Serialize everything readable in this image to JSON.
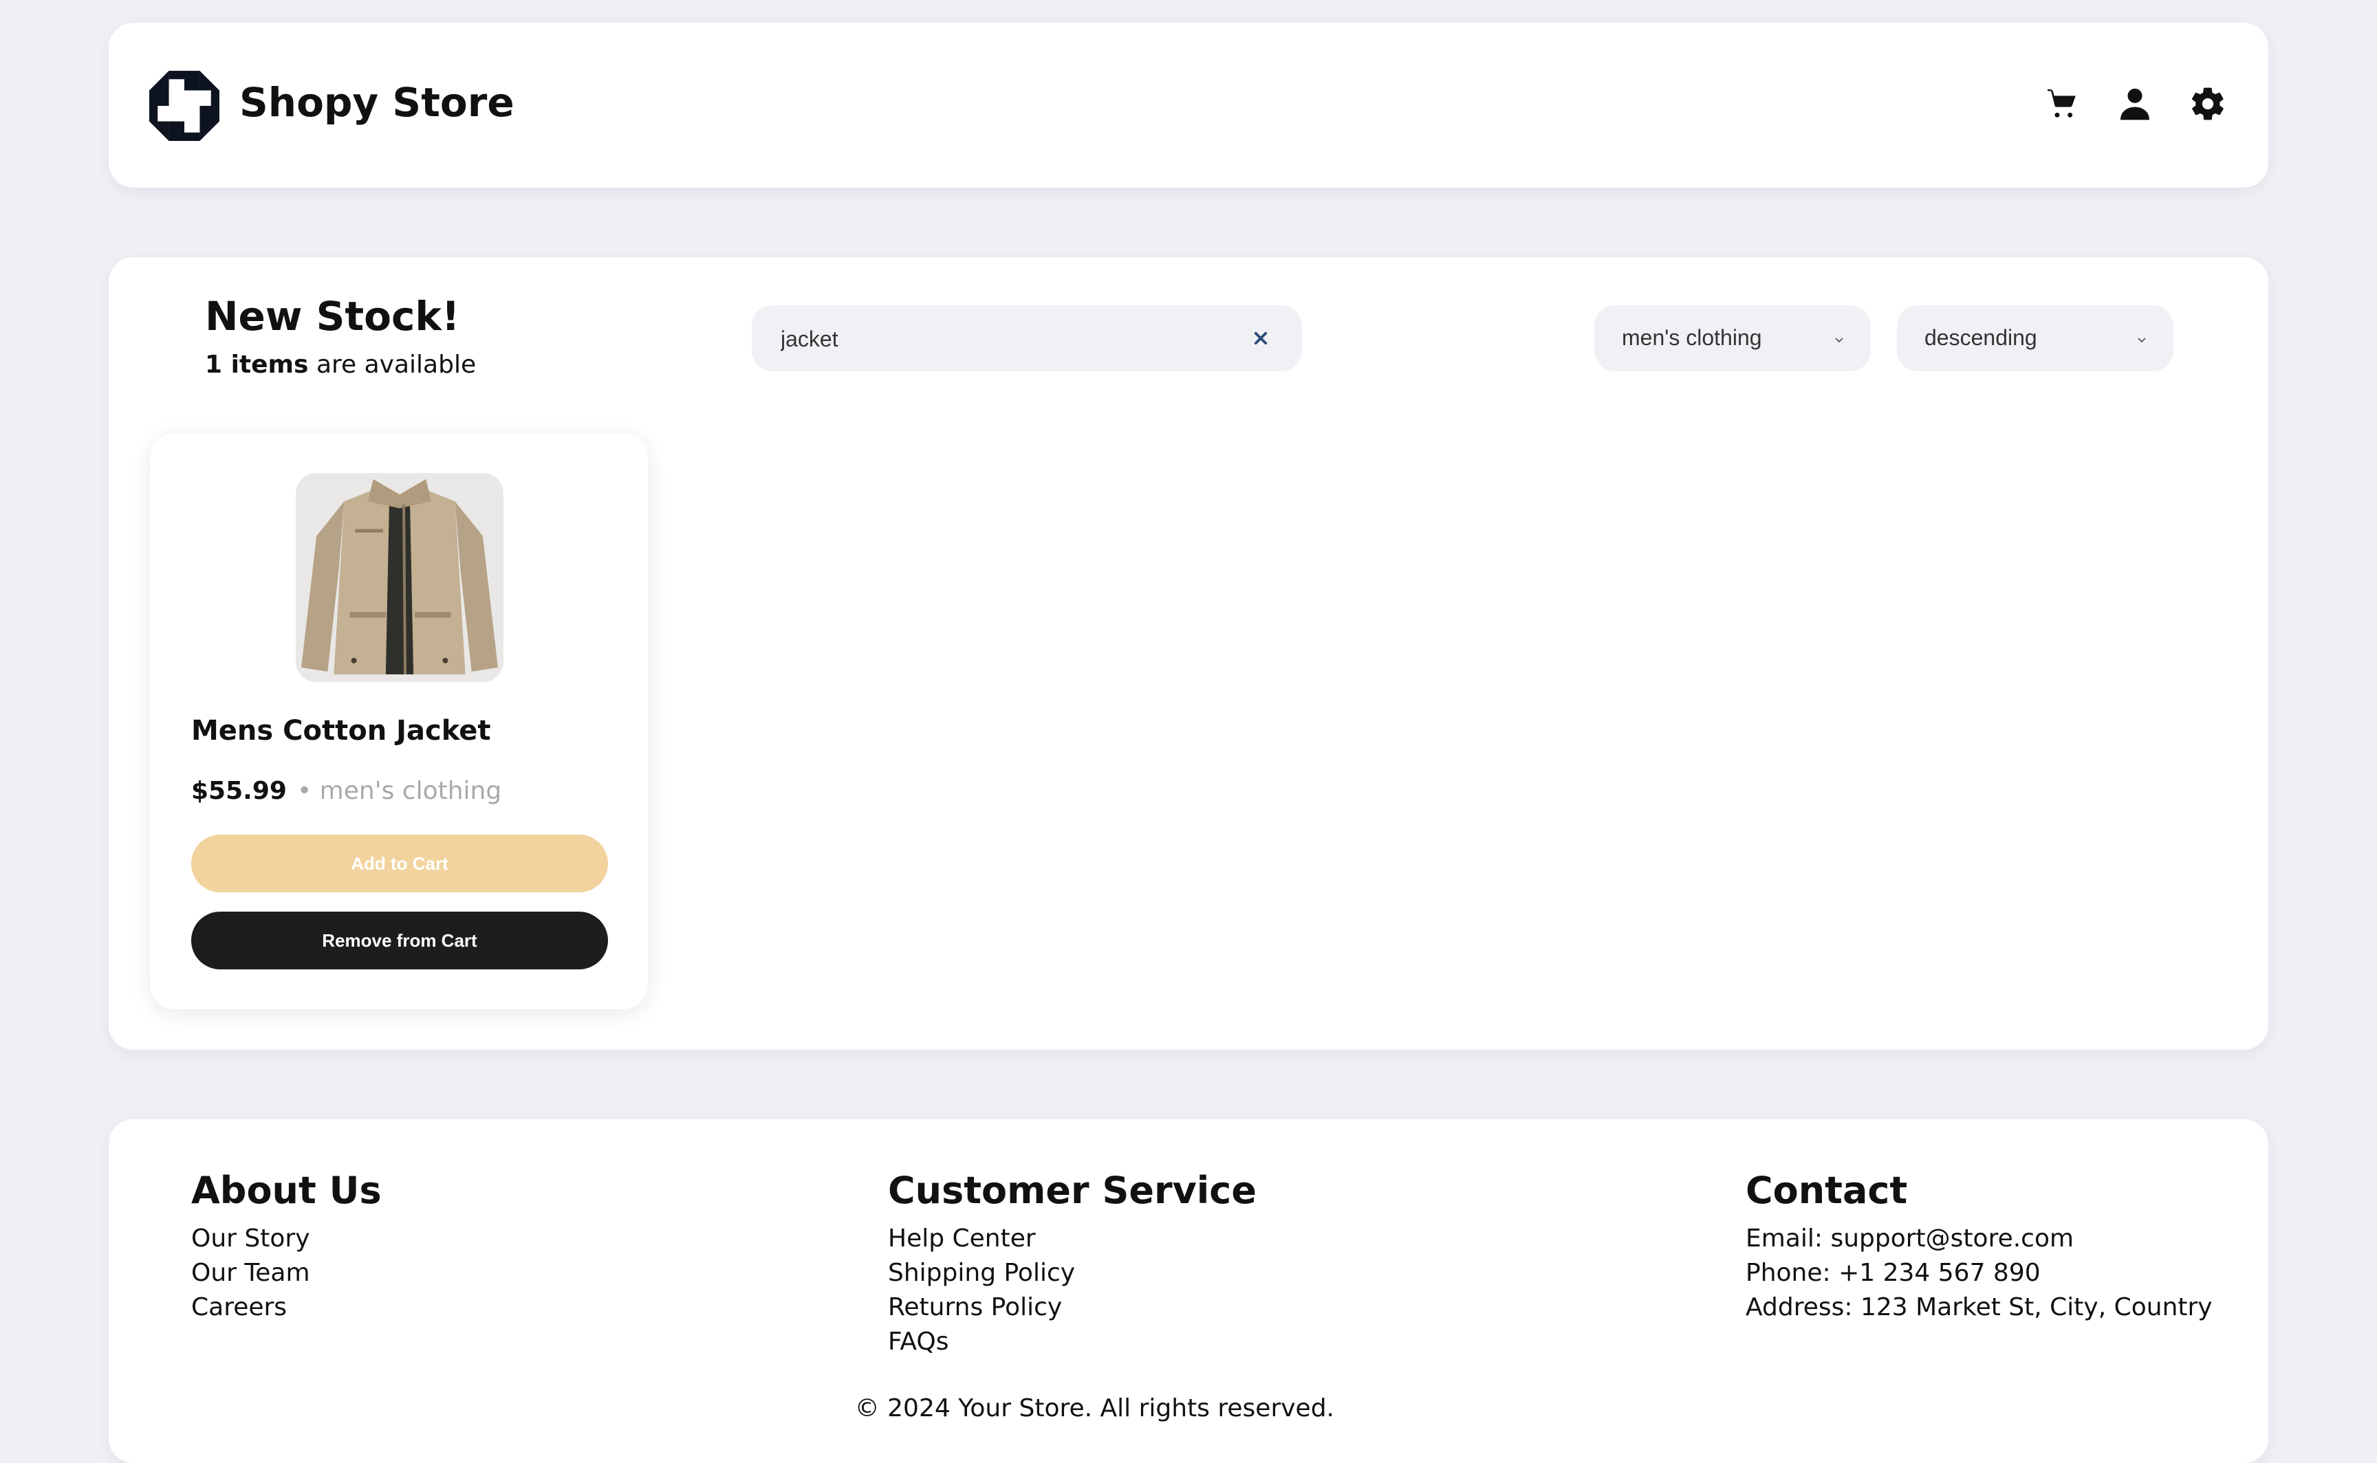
{
  "header": {
    "brand": "Shopy Store",
    "icons": [
      "cart-icon",
      "user-icon",
      "gear-icon"
    ]
  },
  "main": {
    "heading": "New Stock!",
    "count": "1 items",
    "count_suffix": " are available",
    "search": {
      "value": "jacket",
      "placeholder": ""
    },
    "filters": {
      "category": "men's clothing",
      "sort": "descending"
    }
  },
  "products": [
    {
      "name": "Mens Cotton Jacket",
      "price": "$55.99",
      "category": "• men's clothing",
      "add_label": "Add to Cart",
      "remove_label": "Remove from Cart"
    }
  ],
  "footer": {
    "about": {
      "title": "About Us",
      "links": [
        "Our Story",
        "Our Team",
        "Careers"
      ]
    },
    "service": {
      "title": "Customer Service",
      "links": [
        "Help Center",
        "Shipping Policy",
        "Returns Policy",
        "FAQs"
      ]
    },
    "contact": {
      "title": "Contact",
      "lines": [
        "Email: support@store.com",
        "Phone: +1 234 567 890",
        "Address: 123 Market St, City, Country"
      ]
    },
    "copyright": "© 2024 Your Store. All rights reserved."
  },
  "colors": {
    "background": "#eef0f4",
    "accent_button": "#f2d39e",
    "dark_button": "#1d1d1d",
    "clear_icon": "#2d4a7a"
  }
}
